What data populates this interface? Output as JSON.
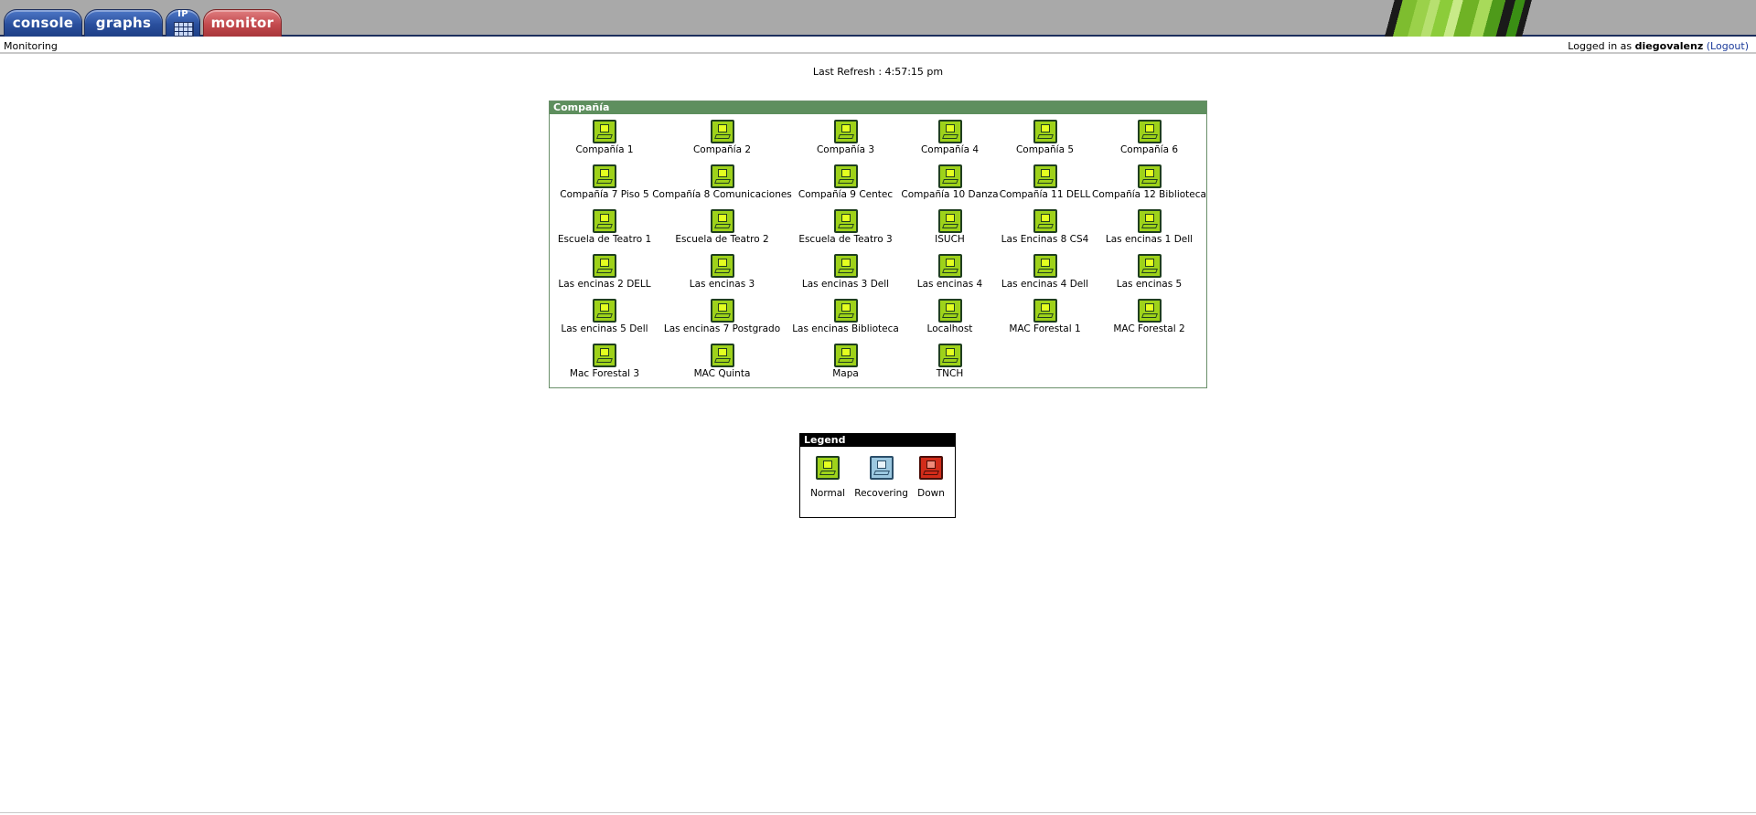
{
  "tabs": {
    "console": "console",
    "graphs": "graphs",
    "ip": "IP",
    "monitor": "monitor"
  },
  "breadcrumb": "Monitoring",
  "login": {
    "prefix": "Logged in as",
    "user": "diegovalenz",
    "logout": "(Logout)"
  },
  "refresh": "Last Refresh : 4:57:15 pm",
  "group": {
    "title": "Compañía",
    "hosts": [
      "Compañía 1",
      "Compañía 2",
      "Compañía 3",
      "Compañía 4",
      "Compañía 5",
      "Compañía 6",
      "Compañía 7 Piso 5",
      "Compañía 8 Comunicaciones",
      "Compañía 9 Centec",
      "Compañía 10 Danza",
      "Compañía 11 DELL",
      "Compañía 12 Biblioteca",
      "Escuela de Teatro 1",
      "Escuela de Teatro 2",
      "Escuela de Teatro 3",
      "ISUCH",
      "Las Encinas 8 CS4",
      "Las encinas 1 Dell",
      "Las encinas 2 DELL",
      "Las encinas 3",
      "Las encinas 3 Dell",
      "Las encinas 4",
      "Las encinas 4 Dell",
      "Las encinas 5",
      "Las encinas 5 Dell",
      "Las encinas 7 Postgrado",
      "Las encinas Biblioteca",
      "Localhost",
      "MAC Forestal 1",
      "MAC Forestal 2",
      "Mac Forestal 3",
      "MAC Quinta",
      "Mapa",
      "TNCH"
    ],
    "host_status": "normal",
    "status_colors": {
      "normal": "#9ed21a",
      "recovering": "#9cc8e0",
      "down": "#d22c1a"
    }
  },
  "legend": {
    "title": "Legend",
    "items": [
      {
        "label": "Normal",
        "status": "normal"
      },
      {
        "label": "Recovering",
        "status": "recovering"
      },
      {
        "label": "Down",
        "status": "down"
      }
    ]
  },
  "icons": {
    "host": "monitor-terminal-icon",
    "banner": "green-stripes-logo"
  },
  "colors": {
    "tab_blue": "#2a4f9d",
    "tab_red": "#c34a4e",
    "group_header": "#5e8f5e",
    "topbar": "#a9a9a9"
  }
}
